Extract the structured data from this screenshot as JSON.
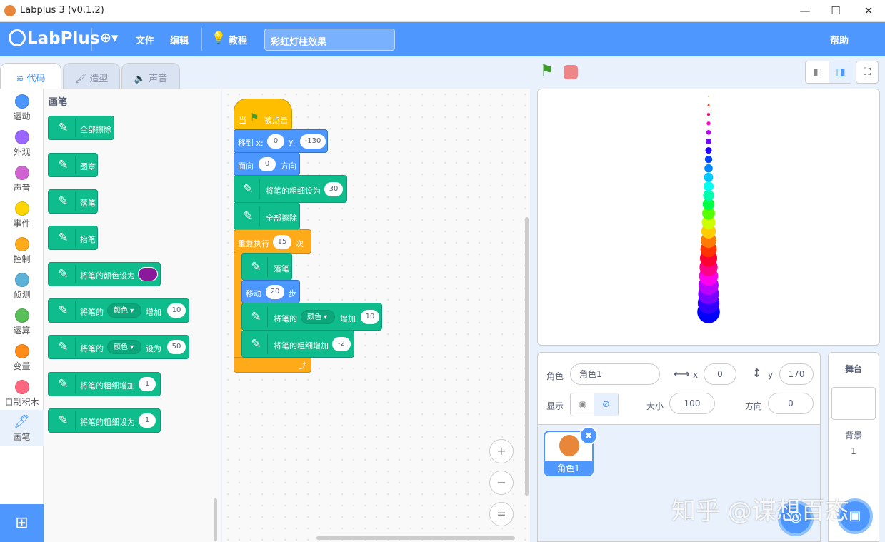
{
  "window": {
    "title": "Labplus 3 (v0.1.2)",
    "minimize": "—",
    "maximize": "☐",
    "close": "✕"
  },
  "menubar": {
    "brand": "LabPlus",
    "language_icon": "globe-icon",
    "file": "文件",
    "edit": "编辑",
    "tutorials": "教程",
    "project_title": "彩虹灯柱效果",
    "help": "帮助"
  },
  "tabs": [
    {
      "label": "代码",
      "active": true
    },
    {
      "label": "造型"
    },
    {
      "label": "声音"
    }
  ],
  "categories": [
    {
      "label": "运动",
      "color": "#4c97ff"
    },
    {
      "label": "外观",
      "color": "#9966ff"
    },
    {
      "label": "声音",
      "color": "#cf63cf"
    },
    {
      "label": "事件",
      "color": "#ffd500"
    },
    {
      "label": "控制",
      "color": "#ffab19"
    },
    {
      "label": "侦测",
      "color": "#5cb1d6"
    },
    {
      "label": "运算",
      "color": "#59c059"
    },
    {
      "label": "变量",
      "color": "#ff8c1a"
    },
    {
      "label": "自制积木",
      "color": "#ff6680"
    },
    {
      "label": "画笔",
      "color": "#0fbd8c"
    }
  ],
  "palette": {
    "title": "画笔",
    "blocks": {
      "clear": "全部擦除",
      "stamp": "图章",
      "pen_down": "落笔",
      "pen_up": "抬笔",
      "set_color": "将笔的颜色设为",
      "set_color_swatch": "#8a1a9b",
      "change_param_pre": "将笔的",
      "change_param_dd": "颜色",
      "change_param_post": "增加",
      "change_param_val": "10",
      "set_param_pre": "将笔的",
      "set_param_dd": "颜色",
      "set_param_post": "设为",
      "set_param_val": "50",
      "change_size": "将笔的粗细增加",
      "change_size_val": "1",
      "set_size": "将笔的粗细设为",
      "set_size_val": "1"
    }
  },
  "script": {
    "hat_pre": "当",
    "hat_post": "被点击",
    "goto_label": "移到 x:",
    "goto_x": "0",
    "goto_y_label": "y:",
    "goto_y": "-130",
    "point_pre": "面向",
    "point_val": "0",
    "point_post": "方向",
    "set_size": "将笔的粗细设为",
    "set_size_val": "30",
    "clear": "全部擦除",
    "repeat_pre": "重复执行",
    "repeat_val": "15",
    "repeat_post": "次",
    "pen_down": "落笔",
    "move_pre": "移动",
    "move_val": "20",
    "move_post": "步",
    "change_pre": "将笔的",
    "change_dd": "颜色",
    "change_post": "增加",
    "change_val": "10",
    "change_size": "将笔的粗细增加",
    "change_size_val": "-2",
    "loop_arrow": "⤴"
  },
  "zoom": {
    "in": "+",
    "out": "−",
    "reset": "="
  },
  "stage_colors": [
    "#0000ff",
    "#3300ff",
    "#7a00ff",
    "#bb00ff",
    "#ff00ee",
    "#ff0088",
    "#ff0033",
    "#ff3300",
    "#ff7a00",
    "#ffcc00",
    "#ccff00",
    "#55ff00",
    "#00ff44",
    "#00ffaa",
    "#00ffee",
    "#00c8ff",
    "#0088ff",
    "#0044ff",
    "#2200ff",
    "#7000ff",
    "#c000ff",
    "#ff00cc",
    "#ff0066",
    "#ff2200",
    "#ff8800"
  ],
  "sprite_info": {
    "sprite_label": "角色",
    "sprite_name": "角色1",
    "x_label": "x",
    "x": "0",
    "y_label": "y",
    "y": "170",
    "show_label": "显示",
    "size_label": "大小",
    "size": "100",
    "direction_label": "方向",
    "direction": "0"
  },
  "sprites": [
    {
      "name": "角色1"
    }
  ],
  "stage_panel": {
    "title": "舞台",
    "backdrops_label": "背景",
    "backdrops_count": "1"
  },
  "watermark": "知乎 @谋想百态"
}
